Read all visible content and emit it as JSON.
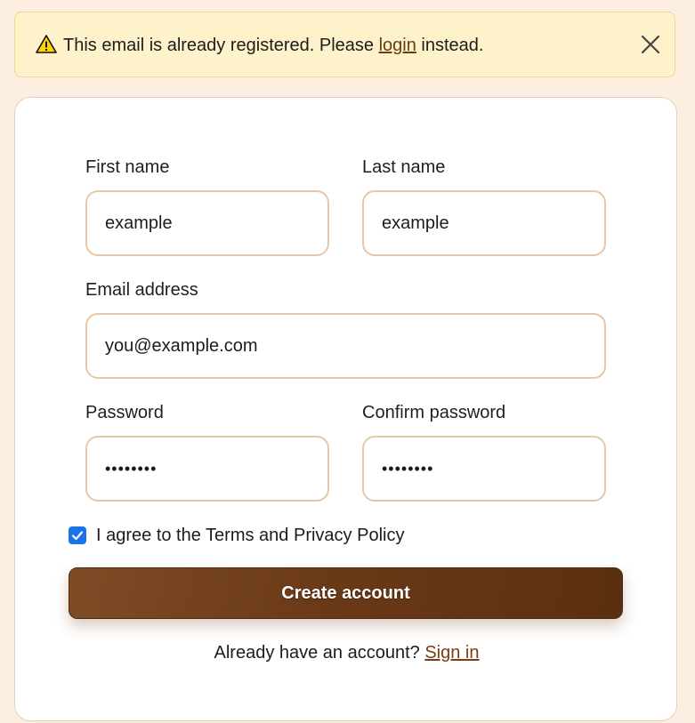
{
  "alert": {
    "message_prefix": "This email is already registered. Please ",
    "login_link": "login",
    "message_suffix": " instead.",
    "icon": "warning-icon",
    "close_icon": "close-icon"
  },
  "form": {
    "first_name": {
      "label": "First name",
      "value": "example"
    },
    "last_name": {
      "label": "Last name",
      "value": "example"
    },
    "email": {
      "label": "Email address",
      "value": "you@example.com"
    },
    "password": {
      "label": "Password",
      "value": "••••••••"
    },
    "confirm_password": {
      "label": "Confirm password",
      "value": "••••••••"
    },
    "agree": {
      "label": "I agree to the Terms and Privacy Policy",
      "checked": true
    },
    "submit_label": "Create account",
    "signin_prompt": "Already have an account? ",
    "signin_link": "Sign in"
  },
  "colors": {
    "background": "#fdeee2",
    "alert_bg": "#fef2cb",
    "accent": "#6b3a18",
    "checkbox": "#1a73e8",
    "field_border": "#e6c7a8"
  }
}
